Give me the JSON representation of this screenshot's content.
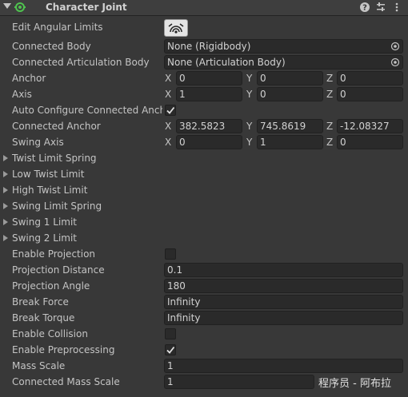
{
  "header": {
    "title": "Character Joint",
    "icons": [
      "fold-arrow-icon",
      "enabled-check-icon",
      "help-icon",
      "presets-icon",
      "more-icon"
    ]
  },
  "fields": {
    "edit_angular_limits": {
      "label": "Edit Angular Limits",
      "icon": "angular-limits-edit-icon"
    },
    "connected_body": {
      "label": "Connected Body",
      "value": "None (Rigidbody)"
    },
    "connected_articulation_body": {
      "label": "Connected Articulation Body",
      "value": "None (Articulation Body)"
    },
    "anchor": {
      "label": "Anchor",
      "x": "0",
      "y": "0",
      "z": "0"
    },
    "axis": {
      "label": "Axis",
      "x": "1",
      "y": "0",
      "z": "0"
    },
    "auto_configure": {
      "label": "Auto Configure Connected Ancho",
      "checked": true
    },
    "connected_anchor": {
      "label": "Connected Anchor",
      "x": "382.5823",
      "y": "745.8619",
      "z": "-12.08327"
    },
    "swing_axis": {
      "label": "Swing Axis",
      "x": "0",
      "y": "1",
      "z": "0"
    }
  },
  "foldouts": [
    "Twist Limit Spring",
    "Low Twist Limit",
    "High Twist Limit",
    "Swing Limit Spring",
    "Swing 1 Limit",
    "Swing 2 Limit"
  ],
  "projection": {
    "enable": {
      "label": "Enable Projection",
      "checked": false
    },
    "distance": {
      "label": "Projection Distance",
      "value": "0.1"
    },
    "angle": {
      "label": "Projection Angle",
      "value": "180"
    }
  },
  "breaking": {
    "force": {
      "label": "Break Force",
      "value": "Infinity"
    },
    "torque": {
      "label": "Break Torque",
      "value": "Infinity"
    }
  },
  "misc": {
    "collision": {
      "label": "Enable Collision",
      "checked": false
    },
    "preprocessing": {
      "label": "Enable Preprocessing",
      "checked": true
    },
    "mass_scale": {
      "label": "Mass Scale",
      "value": "1"
    },
    "connected_mass_scale": {
      "label": "Connected Mass Scale",
      "value": "1"
    }
  },
  "axis_letters": {
    "x": "X",
    "y": "Y",
    "z": "Z"
  },
  "watermark": "程序员 - 阿布拉",
  "colors": {
    "panel": "#383838",
    "field": "#2a2a2a",
    "accent": "#4fc34f",
    "text": "#c4c4c4"
  }
}
